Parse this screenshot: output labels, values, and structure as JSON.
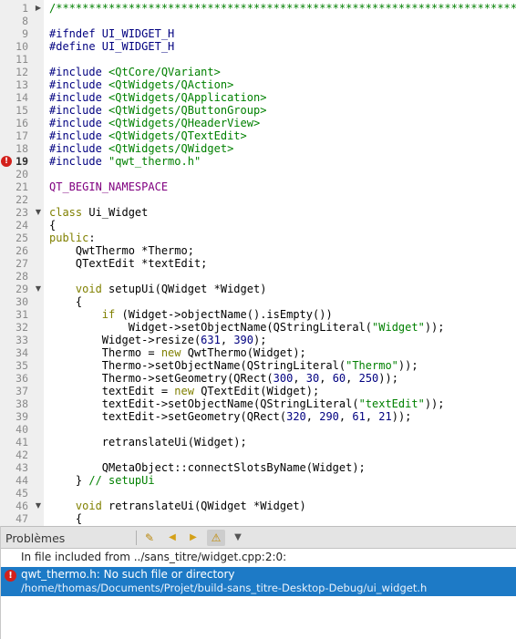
{
  "editor": {
    "current_line": "19",
    "lines": [
      {
        "n": "1",
        "fold": "right",
        "tokens": [
          {
            "t": "/*****************************************************************************",
            "c": "cmt"
          }
        ]
      },
      {
        "n": "8",
        "tokens": []
      },
      {
        "n": "9",
        "tokens": [
          {
            "t": "#ifndef UI_WIDGET_H",
            "c": "pp"
          }
        ]
      },
      {
        "n": "10",
        "tokens": [
          {
            "t": "#define UI_WIDGET_H",
            "c": "pp"
          }
        ]
      },
      {
        "n": "11",
        "tokens": []
      },
      {
        "n": "12",
        "tokens": [
          {
            "t": "#include ",
            "c": "pp"
          },
          {
            "t": "<QtCore/QVariant>",
            "c": "inc"
          }
        ]
      },
      {
        "n": "13",
        "tokens": [
          {
            "t": "#include ",
            "c": "pp"
          },
          {
            "t": "<QtWidgets/QAction>",
            "c": "inc"
          }
        ]
      },
      {
        "n": "14",
        "tokens": [
          {
            "t": "#include ",
            "c": "pp"
          },
          {
            "t": "<QtWidgets/QApplication>",
            "c": "inc"
          }
        ]
      },
      {
        "n": "15",
        "tokens": [
          {
            "t": "#include ",
            "c": "pp"
          },
          {
            "t": "<QtWidgets/QButtonGroup>",
            "c": "inc"
          }
        ]
      },
      {
        "n": "16",
        "tokens": [
          {
            "t": "#include ",
            "c": "pp"
          },
          {
            "t": "<QtWidgets/QHeaderView>",
            "c": "inc"
          }
        ]
      },
      {
        "n": "17",
        "tokens": [
          {
            "t": "#include ",
            "c": "pp"
          },
          {
            "t": "<QtWidgets/QTextEdit>",
            "c": "inc"
          }
        ]
      },
      {
        "n": "18",
        "tokens": [
          {
            "t": "#include ",
            "c": "pp"
          },
          {
            "t": "<QtWidgets/QWidget>",
            "c": "inc"
          }
        ]
      },
      {
        "n": "19",
        "error": true,
        "tokens": [
          {
            "t": "#include ",
            "c": "pp"
          },
          {
            "t": "\"qwt_thermo.h\"",
            "c": "inc"
          }
        ]
      },
      {
        "n": "20",
        "tokens": []
      },
      {
        "n": "21",
        "tokens": [
          {
            "t": "QT_BEGIN_NAMESPACE",
            "c": "mac"
          }
        ]
      },
      {
        "n": "22",
        "tokens": []
      },
      {
        "n": "23",
        "fold": "down",
        "tokens": [
          {
            "t": "class",
            "c": "kw"
          },
          {
            "t": " Ui_Widget"
          }
        ]
      },
      {
        "n": "24",
        "tokens": [
          {
            "t": "{"
          }
        ]
      },
      {
        "n": "25",
        "tokens": [
          {
            "t": "public",
            "c": "kw"
          },
          {
            "t": ":"
          }
        ]
      },
      {
        "n": "26",
        "tokens": [
          {
            "t": "    QwtThermo *Thermo;"
          }
        ]
      },
      {
        "n": "27",
        "tokens": [
          {
            "t": "    QTextEdit *textEdit;"
          }
        ]
      },
      {
        "n": "28",
        "tokens": []
      },
      {
        "n": "29",
        "fold": "down",
        "tokens": [
          {
            "t": "    "
          },
          {
            "t": "void",
            "c": "kw"
          },
          {
            "t": " setupUi(QWidget *Widget)"
          }
        ]
      },
      {
        "n": "30",
        "tokens": [
          {
            "t": "    {"
          }
        ]
      },
      {
        "n": "31",
        "tokens": [
          {
            "t": "        "
          },
          {
            "t": "if",
            "c": "kw"
          },
          {
            "t": " (Widget->objectName().isEmpty())"
          }
        ]
      },
      {
        "n": "32",
        "tokens": [
          {
            "t": "            Widget->setObjectName(QStringLiteral("
          },
          {
            "t": "\"Widget\"",
            "c": "str"
          },
          {
            "t": "));"
          }
        ]
      },
      {
        "n": "33",
        "tokens": [
          {
            "t": "        Widget->resize("
          },
          {
            "t": "631",
            "c": "num"
          },
          {
            "t": ", "
          },
          {
            "t": "390",
            "c": "num"
          },
          {
            "t": ");"
          }
        ]
      },
      {
        "n": "34",
        "tokens": [
          {
            "t": "        Thermo = "
          },
          {
            "t": "new",
            "c": "kw"
          },
          {
            "t": " QwtThermo(Widget);"
          }
        ]
      },
      {
        "n": "35",
        "tokens": [
          {
            "t": "        Thermo->setObjectName(QStringLiteral("
          },
          {
            "t": "\"Thermo\"",
            "c": "str"
          },
          {
            "t": "));"
          }
        ]
      },
      {
        "n": "36",
        "tokens": [
          {
            "t": "        Thermo->setGeometry(QRect("
          },
          {
            "t": "300",
            "c": "num"
          },
          {
            "t": ", "
          },
          {
            "t": "30",
            "c": "num"
          },
          {
            "t": ", "
          },
          {
            "t": "60",
            "c": "num"
          },
          {
            "t": ", "
          },
          {
            "t": "250",
            "c": "num"
          },
          {
            "t": "));"
          }
        ]
      },
      {
        "n": "37",
        "tokens": [
          {
            "t": "        textEdit = "
          },
          {
            "t": "new",
            "c": "kw"
          },
          {
            "t": " QTextEdit(Widget);"
          }
        ]
      },
      {
        "n": "38",
        "tokens": [
          {
            "t": "        textEdit->setObjectName(QStringLiteral("
          },
          {
            "t": "\"textEdit\"",
            "c": "str"
          },
          {
            "t": "));"
          }
        ]
      },
      {
        "n": "39",
        "tokens": [
          {
            "t": "        textEdit->setGeometry(QRect("
          },
          {
            "t": "320",
            "c": "num"
          },
          {
            "t": ", "
          },
          {
            "t": "290",
            "c": "num"
          },
          {
            "t": ", "
          },
          {
            "t": "61",
            "c": "num"
          },
          {
            "t": ", "
          },
          {
            "t": "21",
            "c": "num"
          },
          {
            "t": "));"
          }
        ]
      },
      {
        "n": "40",
        "tokens": []
      },
      {
        "n": "41",
        "tokens": [
          {
            "t": "        retranslateUi(Widget);"
          }
        ]
      },
      {
        "n": "42",
        "tokens": []
      },
      {
        "n": "43",
        "tokens": [
          {
            "t": "        QMetaObject::connectSlotsByName(Widget);"
          }
        ]
      },
      {
        "n": "44",
        "tokens": [
          {
            "t": "    } "
          },
          {
            "t": "// setupUi",
            "c": "cmt"
          }
        ]
      },
      {
        "n": "45",
        "tokens": []
      },
      {
        "n": "46",
        "fold": "down",
        "tokens": [
          {
            "t": "    "
          },
          {
            "t": "void",
            "c": "kw"
          },
          {
            "t": " retranslateUi(QWidget *Widget)"
          }
        ]
      },
      {
        "n": "47",
        "tokens": [
          {
            "t": "    {"
          }
        ]
      }
    ]
  },
  "panel": {
    "title": "Problèmes",
    "toolbar": [
      {
        "name": "clean-icon",
        "glyph": "✎"
      },
      {
        "name": "previous-icon",
        "glyph": "◀"
      },
      {
        "name": "next-icon",
        "glyph": "▶"
      },
      {
        "name": "warning-filter-icon",
        "glyph": "⚠"
      },
      {
        "name": "filter-icon",
        "glyph": "▼"
      }
    ],
    "info_message": "In file included from ../sans_titre/widget.cpp:2:0:",
    "error_message": "qwt_thermo.h: No such file or directory",
    "error_path": "/home/thomas/Documents/Projet/build-sans_titre-Desktop-Debug/ui_widget.h",
    "error_icon": "!"
  },
  "colors": {
    "keyword": "#808000",
    "string": "#008000",
    "number": "#000080",
    "comment": "#008000",
    "macro": "#800080",
    "selection": "#1d7ac6",
    "error": "#d3201b"
  }
}
